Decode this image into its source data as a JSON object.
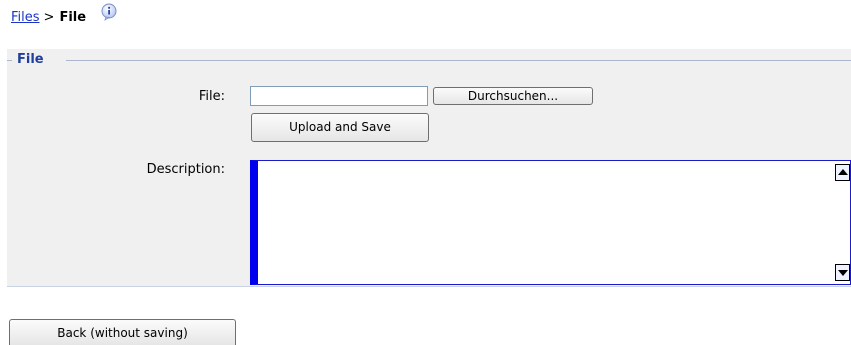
{
  "breadcrumb": {
    "parent_link": "Files",
    "separator": ">",
    "current": "File",
    "info_icon": "info-icon"
  },
  "fieldset": {
    "legend": "File"
  },
  "form": {
    "file_label": "File:",
    "file_value": "",
    "browse_button": "Durchsuchen...",
    "upload_button": "Upload and Save",
    "description_label": "Description:",
    "description_value": ""
  },
  "footer": {
    "back_button": "Back (without saving)"
  }
}
